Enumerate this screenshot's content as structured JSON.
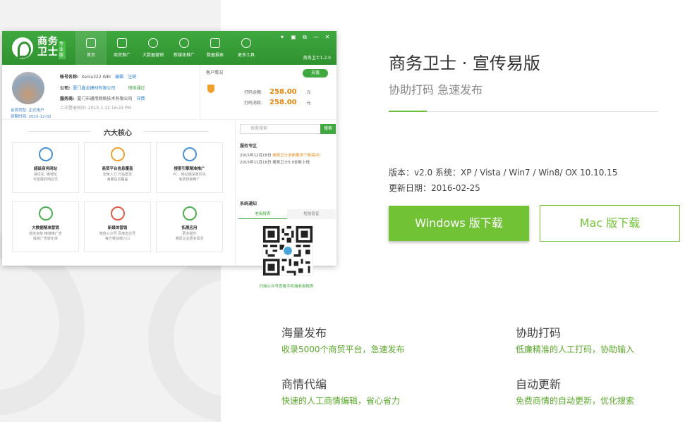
{
  "app": {
    "brand_top": "商务",
    "brand_bottom": "卫士",
    "brand_tag": "专业版",
    "nav": [
      "首页",
      "商贸推广",
      "大数据营销",
      "新媒体推广",
      "数据报表",
      "更多工具"
    ],
    "window_buttons": [
      "▾",
      "▣",
      "⧉",
      "—",
      "✕"
    ],
    "user_info": "商务卫士1.2.0",
    "account": {
      "username_label": "帐号名称:",
      "username": "Xenia322 WEI",
      "edit": "编辑",
      "logout": "注销",
      "company_label": "公司:",
      "company": "厦门鑫龙建材有限公司",
      "verified": "审核通过",
      "provider_label": "服务商:",
      "provider": "厦门市通用网络技术有限公司",
      "provider_link": "详情",
      "last_login": "上次登录时间: 2015-1-12 16:24 PM",
      "member_type": "会员类型: 正式用户",
      "expire": "到期时间: 2015-12-02"
    },
    "customer": {
      "title": "客户情况",
      "recharge": "充值",
      "balance_label": "打码余额:",
      "balance": "258.00",
      "unit": "元",
      "consume_label": "打码消耗:",
      "consume": "258.00"
    },
    "core": {
      "title": "六大核心",
      "cards": [
        {
          "title": "超级商务网站",
          "desc": "易优化, 刷榜化\n可拓展的响应式"
        },
        {
          "title": "商贸平台信息覆盖",
          "desc": "全免人力 万站群发\n海量信息覆盖"
        },
        {
          "title": "搜索引擎精准推广",
          "desc": "PC、移动端深度优化\n免费搜索推广"
        },
        {
          "title": "大数据精准营销",
          "desc": "锁定目标 精准推广告\n提高广告转化率"
        },
        {
          "title": "新媒体营销",
          "desc": "微信公众号 百度直达号\n每方移动端入口"
        },
        {
          "title": "拓展应用",
          "desc": "更多插件\n满足企业更多需求"
        }
      ]
    },
    "side": {
      "search_placeholder": "搜索搜索",
      "search_button": "搜索",
      "service_title": "服务专区",
      "service_items": [
        {
          "date": "2015年12月18日",
          "text": "商务卫士全新更多个新亮点!"
        },
        {
          "date": "2015年11月18日",
          "text": "商务卫士5.0全新上线"
        }
      ],
      "notice_title": "系统通知",
      "tabs": [
        "老板报表",
        "短信验证"
      ],
      "qr_caption": "扫描公众号查看手机端老板报表"
    }
  },
  "product": {
    "title": "商务卫士 · 宣传易版",
    "subtitle": "协助打码 急速发布",
    "version": "版本：v2.0 系统：XP / Vista / Win7 / Win8/ OX 10.10.15",
    "update_date": "更新日期：2016-02-25",
    "windows_download": "Windows 版下载",
    "mac_download": "Mac 版下载"
  },
  "features": [
    {
      "title": "海量发布",
      "desc": "收录5000个商贸平台，急速发布"
    },
    {
      "title": "协助打码",
      "desc": "低廉精准的人工打码，协助输入"
    },
    {
      "title": "商情代编",
      "desc": "快速的人工商情编辑，省心省力"
    },
    {
      "title": "自动更新",
      "desc": "免费商情的自动更新，优化搜索"
    }
  ],
  "colors": {
    "brand_green": "#3fa83f",
    "download_green": "#72c236",
    "feature_desc_green": "#5aa82b",
    "amount_orange": "#e8860d"
  }
}
